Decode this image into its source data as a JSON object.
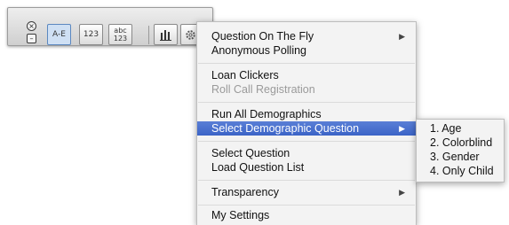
{
  "toolbar": {
    "close_icon": "close-icon",
    "minimize_icon": "minimize-icon",
    "buttons": [
      {
        "label": "A-E",
        "icon": "multiple-choice-icon"
      },
      {
        "label": "123",
        "icon": "numeric-icon"
      },
      {
        "label": "abc\n123",
        "icon": "alphanumeric-icon"
      },
      {
        "label": "",
        "icon": "chart-bars-icon"
      },
      {
        "label": "",
        "icon": "gear-icon"
      }
    ]
  },
  "menu": {
    "items": [
      {
        "label": "Question On The Fly",
        "has_submenu": true,
        "enabled": true
      },
      {
        "label": "Anonymous Polling",
        "enabled": true
      },
      {
        "label": "Loan Clickers",
        "enabled": true
      },
      {
        "label": "Roll Call Registration",
        "enabled": false
      },
      {
        "label": "Run All Demographics",
        "enabled": true
      },
      {
        "label": "Select Demographic Question",
        "has_submenu": true,
        "enabled": true,
        "highlighted": true
      },
      {
        "label": "Select Question",
        "enabled": true
      },
      {
        "label": "Load Question List",
        "enabled": true
      },
      {
        "label": "Transparency",
        "has_submenu": true,
        "enabled": true
      },
      {
        "label": "My Settings",
        "enabled": true
      }
    ],
    "submenu_arrow": "▶"
  },
  "submenu": {
    "items": [
      "1. Age",
      "2. Colorblind",
      "3. Gender",
      "4. Only Child"
    ]
  },
  "colors": {
    "highlight": "#3b64c7",
    "highlight_text": "#ffffff",
    "disabled_text": "#9a9a9a",
    "menu_bg": "#f3f3f3"
  }
}
